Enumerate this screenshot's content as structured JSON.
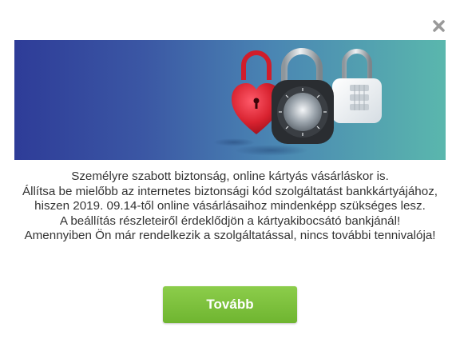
{
  "dialog": {
    "close_icon": "close-icon",
    "banner_image": "padlocks-banner",
    "message_lines": [
      "Személyre szabott biztonság, online kártyás vásárláskor is.",
      "Állítsa be mielőbb az internetes biztonsági kód szolgáltatást bankkártyájához, hiszen 2019. 09.14-től online vásárlásaihoz mindenképp szükséges lesz.",
      "A beállítás részleteiről érdeklődjön a kártyakibocsátó bankjánál!",
      "Amennyiben Ön már rendelkezik a szolgáltatással, nincs további tennivalója!"
    ],
    "continue_label": "Tovább"
  },
  "colors": {
    "button": "#7cc13c",
    "text": "#333333",
    "banner_left": "#2e3c98",
    "banner_right": "#5ab7ad"
  }
}
